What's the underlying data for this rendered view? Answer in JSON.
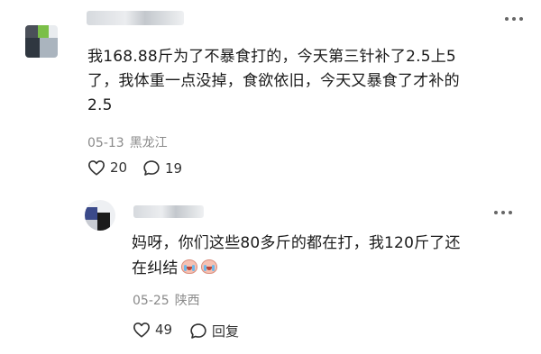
{
  "comment": {
    "avatar_icon": "user-avatar-icon",
    "text_lines": [
      "我168.88斤为了不暴食打的，今天第三针补了2.5上5",
      "了，我体重一点没掉，食欲依旧，今天又暴食了才补的",
      "2.5"
    ],
    "date": "05-13",
    "location": "黑龙江",
    "likes": "20",
    "replies": "19",
    "like_icon": "heart-outline-icon",
    "reply_icon": "comment-bubble-icon",
    "more_icon": "more-dots-icon"
  },
  "reply": {
    "avatar_icon": "user-avatar-icon",
    "text_lines": [
      "妈呀，你们这些80多斤的都在打，我120斤了还",
      "在纠结"
    ],
    "emojis": [
      "crying-face-icon",
      "crying-face-icon"
    ],
    "date": "05-25",
    "location": "陕西",
    "likes": "49",
    "reply_label": "回复",
    "like_icon": "heart-outline-icon",
    "reply_icon": "comment-bubble-icon",
    "more_icon": "more-dots-icon"
  },
  "colors": {
    "text": "#1a1a1a",
    "meta": "#8a8a8a",
    "icon": "#333333",
    "background": "#ffffff"
  }
}
